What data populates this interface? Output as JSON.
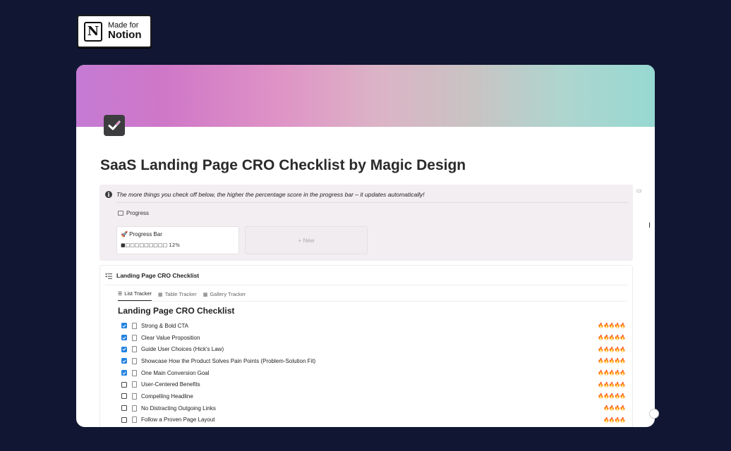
{
  "badge": {
    "small": "Made for",
    "big": "Notion",
    "logo_letter": "N"
  },
  "page": {
    "icon": "checkbox-icon",
    "title": "SaaS Landing Page CRO Checklist by Magic Design"
  },
  "callout": {
    "icon": "info-icon",
    "text": "The more things you check off below, the higher the percentage score in the progress bar – it updates automatically!",
    "view_label": "Progress",
    "card_title": "🚀 Progress Bar",
    "card_bar": "■□□□□□□□□□ 12%",
    "progress_fraction": 0.12,
    "new_label": "+ New"
  },
  "database": {
    "title": "Landing Page CRO Checklist",
    "tabs": [
      {
        "label": "List Tracker",
        "active": true,
        "icon": "list-icon"
      },
      {
        "label": "Table Tracker",
        "active": false,
        "icon": "table-icon"
      },
      {
        "label": "Gallery Tracker",
        "active": false,
        "icon": "gallery-icon"
      }
    ],
    "list_title": "Landing Page CRO Checklist",
    "items": [
      {
        "label": "Strong & Bold CTA",
        "checked": true,
        "fires": "🔥🔥🔥🔥🔥"
      },
      {
        "label": "Clear Value Proposition",
        "checked": true,
        "fires": "🔥🔥🔥🔥🔥"
      },
      {
        "label": "Guide User Choices (Hick's Law)",
        "checked": true,
        "fires": "🔥🔥🔥🔥🔥"
      },
      {
        "label": "Showcase How the Product Solves Pain Points (Problem-Solution Fit)",
        "checked": true,
        "fires": "🔥🔥🔥🔥🔥"
      },
      {
        "label": "One Main Conversion Goal",
        "checked": true,
        "fires": "🔥🔥🔥🔥🔥"
      },
      {
        "label": "User-Centered Benefits",
        "checked": false,
        "fires": "🔥🔥🔥🔥🔥"
      },
      {
        "label": "Compelling Headline",
        "checked": false,
        "fires": "🔥🔥🔥🔥🔥"
      },
      {
        "label": "No Distracting Outgoing Links",
        "checked": false,
        "fires": "🔥🔥🔥🔥"
      },
      {
        "label": "Follow a Proven Page Layout",
        "checked": false,
        "fires": "🔥🔥🔥🔥"
      }
    ]
  },
  "colors": {
    "background": "#111733",
    "checkbox_checked": "#2383e2",
    "callout_bg": "#f2eef2"
  }
}
